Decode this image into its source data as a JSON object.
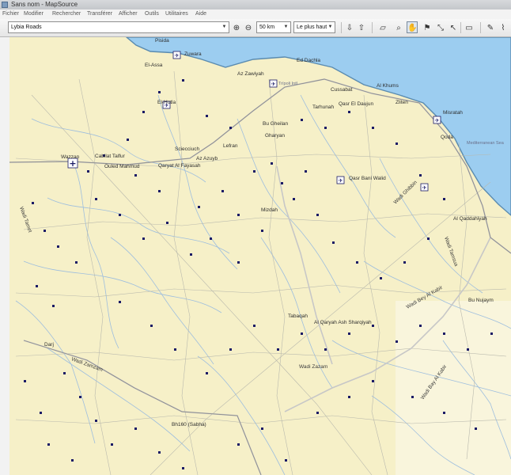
{
  "window": {
    "title": "Sans nom - MapSource"
  },
  "menu": [
    "Fichier",
    "Modifier",
    "Rechercher",
    "Transférer",
    "Afficher",
    "Outils",
    "Utilitaires",
    "Aide"
  ],
  "toolbar": {
    "product": "Lybia Roads",
    "zoom_scale": "50 km",
    "detail": "Le plus haut",
    "icons": [
      "zoom-in-icon",
      "zoom-out-icon",
      "receive-from-device-icon",
      "send-to-device-icon",
      "select-tool-icon",
      "zoom-tool-icon",
      "hand-pan-tool-icon",
      "waypoint-tool-icon",
      "route-tool-icon",
      "pointer-tool-icon",
      "distance-tool-icon",
      "map-tool-icon",
      "track-tool-icon"
    ]
  },
  "map": {
    "sea_label": "Mediterranean Sea",
    "places": [
      {
        "name": "Pisida"
      },
      {
        "name": "Zuwara"
      },
      {
        "name": "El-Assa"
      },
      {
        "name": "Az Zawiyah"
      },
      {
        "name": "Ed Dachla"
      },
      {
        "name": "Trípoli Intl"
      },
      {
        "name": "Al Khums"
      },
      {
        "name": "Cussabat"
      },
      {
        "name": "Tarhunah"
      },
      {
        "name": "Qasr El Daujun"
      },
      {
        "name": "Zliten"
      },
      {
        "name": "Misratah"
      },
      {
        "name": "El-Hotla"
      },
      {
        "name": "Bu Gheilan"
      },
      {
        "name": "Gharyan"
      },
      {
        "name": "Qoda"
      },
      {
        "name": "Wazzan"
      },
      {
        "name": "Cabilat Talfur"
      },
      {
        "name": "Sciecciuch"
      },
      {
        "name": "Lefran"
      },
      {
        "name": "Ouled Mahmud"
      },
      {
        "name": "Qaryat Al Fayasah"
      },
      {
        "name": "Az Azuyb"
      },
      {
        "name": "Qasr Bani Walid"
      },
      {
        "name": "Mizdah"
      },
      {
        "name": "Al Qaddahiyah"
      },
      {
        "name": "Bu Nujaym"
      },
      {
        "name": "Tabaqah"
      },
      {
        "name": "Al Qaryah Ash Sharqiyah"
      },
      {
        "name": "Darj"
      },
      {
        "name": "Wadi Zazam"
      },
      {
        "name": "Bh160 (Sabha)"
      },
      {
        "name": "Wadi Ghibbin"
      },
      {
        "name": "Wadi Tamet"
      },
      {
        "name": "Wadi Zamzam"
      },
      {
        "name": "Wadi Bey Al Kabir"
      },
      {
        "name": "Wadi Tamsua"
      },
      {
        "name": "Wadi Bay Al Kabir"
      }
    ]
  }
}
